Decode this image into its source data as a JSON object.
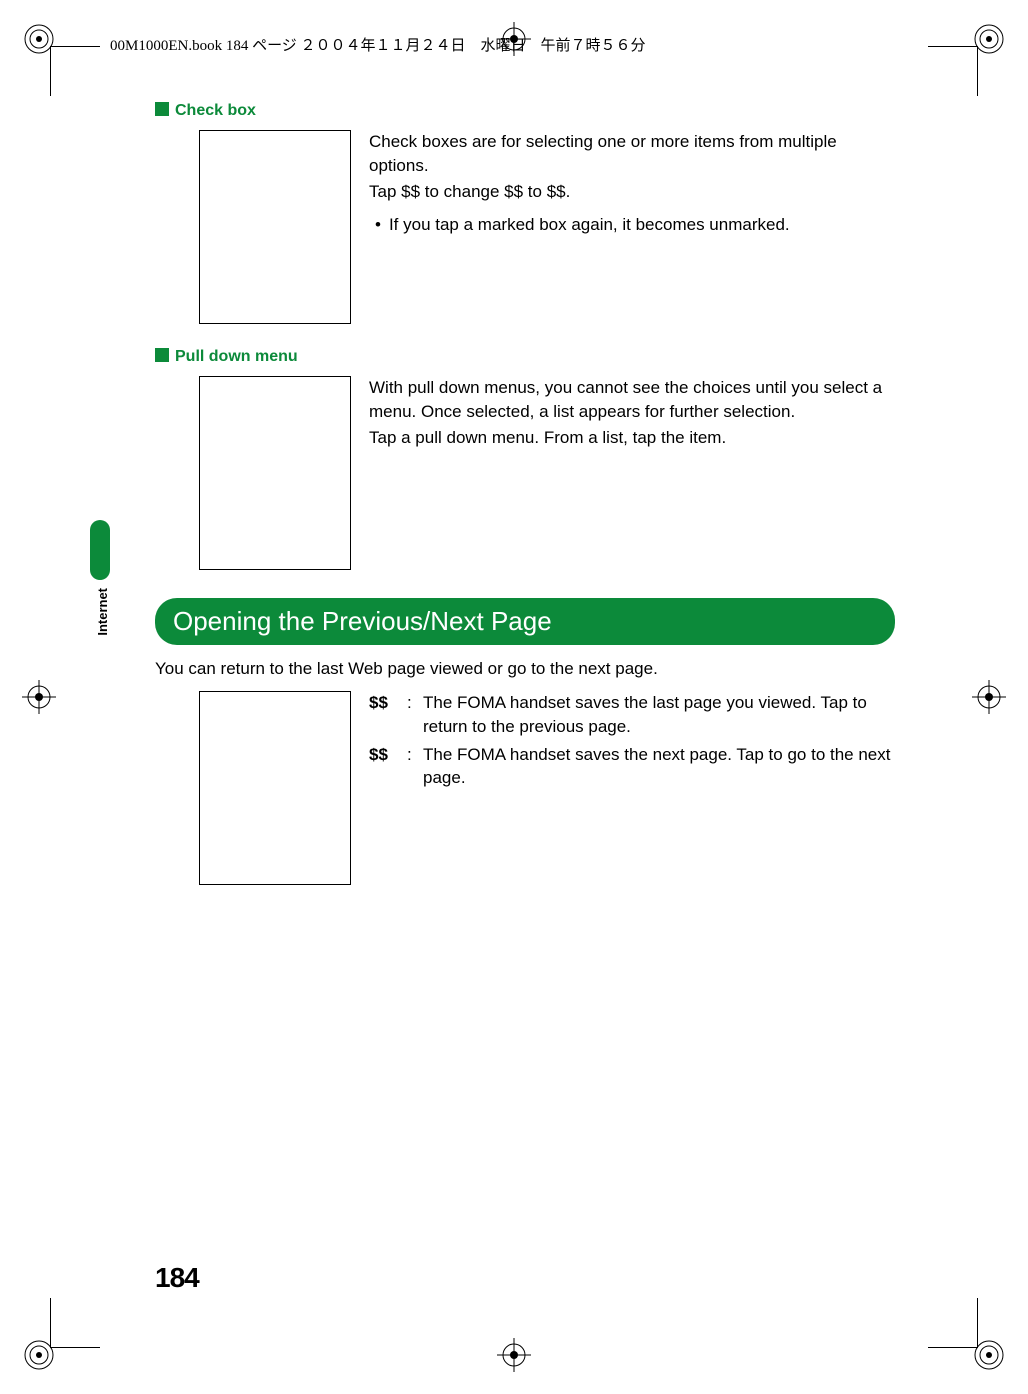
{
  "print_header": "00M1000EN.book  184 ページ  ２００４年１１月２４日　水曜日　午前７時５６分",
  "page_number": "184",
  "side_tab_label": "Internet",
  "sections": {
    "checkbox": {
      "title": "Check box",
      "body": [
        "Check boxes are for selecting one or more items from multiple options.",
        "Tap $$ to change $$ to $$."
      ],
      "bullet": "If you tap a marked box again, it becomes unmarked."
    },
    "pulldown": {
      "title": "Pull down menu",
      "body": [
        "With pull down menus, you cannot see the choices until you select a menu. Once selected, a list appears for further selection.",
        "Tap a pull down menu. From a list, tap the item."
      ]
    },
    "prevnext": {
      "heading": "Opening the Previous/Next Page",
      "intro": "You can return to the last Web page viewed or go to the next page.",
      "items": [
        {
          "key": "$$",
          "value": "The FOMA handset saves the last page you viewed. Tap to return to the previous page."
        },
        {
          "key": "$$",
          "value": "The FOMA handset saves the next page. Tap to go to the next page."
        }
      ]
    }
  }
}
